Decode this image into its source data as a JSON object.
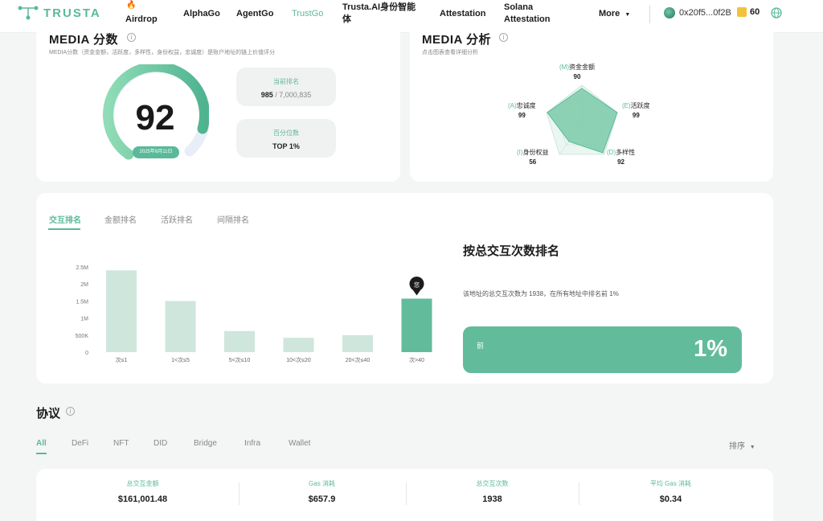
{
  "nav": {
    "logo": "TRUSTA",
    "items": [
      {
        "label": "Airdrop",
        "badge": "🔥"
      },
      {
        "label": "AlphaGo"
      },
      {
        "label": "AgentGo"
      },
      {
        "label": "TrustGo",
        "active": true
      },
      {
        "label_line1": "Trusta.AI身份智能",
        "label_line2": "体"
      },
      {
        "label": "Attestation"
      },
      {
        "label_line1": "Solana",
        "label_line2": "Attestation"
      },
      {
        "label": "More"
      }
    ],
    "wallet_address": "0x20f5...0f2B",
    "points": "60"
  },
  "media_score": {
    "title": "MEDIA 分数",
    "subtitle": "MEDIA分数（资金金额，活跃度，多样性，身份权益，忠诚度）是账户地址的链上价值评分",
    "score": "92",
    "date": "2025年8月11日",
    "rank_label": "当前排名",
    "rank_value": "985",
    "rank_total": "/ 7,000,835",
    "percentile_label": "百分位数",
    "percentile_value": "TOP 1%"
  },
  "media_analysis": {
    "title": "MEDIA 分析",
    "subtitle": "点击图表查看详细分析",
    "dimensions": [
      {
        "key": "(M)",
        "name": "资金金额",
        "value": "90"
      },
      {
        "key": "(E)",
        "name": "活跃度",
        "value": "99"
      },
      {
        "key": "(D)",
        "name": "多样性",
        "value": "92"
      },
      {
        "key": "(I)",
        "name": "身份权益",
        "value": "56"
      },
      {
        "key": "(A)",
        "name": "忠诚度",
        "value": "99"
      }
    ]
  },
  "ranking": {
    "tabs": [
      "交互排名",
      "金额排名",
      "活跃排名",
      "间隔排名"
    ],
    "title": "按总交互次数排名",
    "desc": "该地址的总交互次数为 1938，在所有地址中排名前 1%",
    "box_prefix": "前",
    "box_value": "1%",
    "marker_label": "您"
  },
  "chart_data": {
    "type": "bar",
    "categories": [
      "次≤1",
      "1<次≤5",
      "5<次≤10",
      "10<次≤20",
      "20<次≤40",
      "次>40"
    ],
    "values": [
      2400000,
      1500000,
      620000,
      420000,
      500000,
      1570000
    ],
    "y_ticks": [
      "0",
      "500K",
      "1M",
      "1.5M",
      "2M",
      "2.5M"
    ],
    "ylim": [
      0,
      2500000
    ],
    "highlight_index": 5,
    "colors": {
      "bar": "#cfe6dd",
      "highlight": "#62bc9c"
    }
  },
  "protocol": {
    "title": "协议",
    "tabs": [
      "All",
      "DeFi",
      "NFT",
      "DID",
      "Bridge",
      "Infra",
      "Wallet"
    ],
    "sort_label": "排序",
    "summary": [
      {
        "label": "总交互金额",
        "value": "$161,001.48"
      },
      {
        "label": "Gas 消耗",
        "value": "$657.9"
      },
      {
        "label": "总交互次数",
        "value": "1938"
      },
      {
        "label": "平均 Gas 消耗",
        "value": "$0.34"
      }
    ]
  },
  "colors": {
    "accent": "#5ab99a",
    "accent_dark": "#62bc9c"
  }
}
